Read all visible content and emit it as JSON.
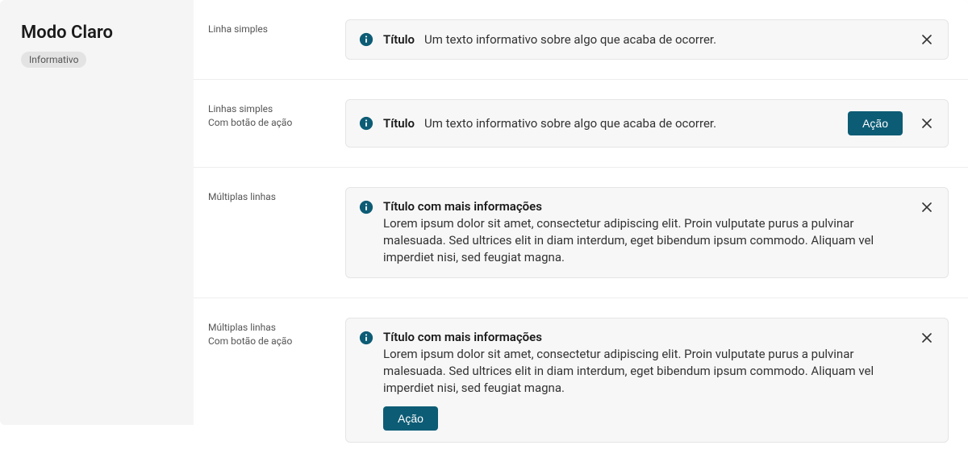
{
  "sidebar": {
    "mode_title": "Modo Claro",
    "tag": "Informativo"
  },
  "colors": {
    "info_icon": "#0d5c75",
    "action_bg": "#0d5c75"
  },
  "rows": [
    {
      "label_line1": "Linha simples",
      "label_line2": "",
      "title": "Título",
      "text": "Um texto informativo sobre algo que acaba de ocorrer.",
      "action": "",
      "multiline": false
    },
    {
      "label_line1": "Linhas simples",
      "label_line2": "Com botão de ação",
      "title": "Título",
      "text": "Um texto informativo sobre algo que acaba de ocorrer.",
      "action": "Ação",
      "multiline": false
    },
    {
      "label_line1": "Múltiplas linhas",
      "label_line2": "",
      "title": "Título com mais informações",
      "text": "Lorem ipsum dolor sit amet, consectetur adipiscing elit. Proin vulputate purus a pulvinar malesuada. Sed ultrices elit in diam interdum, eget bibendum ipsum commodo. Aliquam vel imperdiet nisi, sed feugiat magna.",
      "action": "",
      "multiline": true
    },
    {
      "label_line1": "Múltiplas linhas",
      "label_line2": "Com botão de ação",
      "title": "Título com mais informações",
      "text": "Lorem ipsum dolor sit amet, consectetur adipiscing elit. Proin vulputate purus a pulvinar malesuada. Sed ultrices elit in diam interdum, eget bibendum ipsum commodo. Aliquam vel imperdiet nisi, sed feugiat magna.",
      "action": "Ação",
      "multiline": true
    }
  ]
}
